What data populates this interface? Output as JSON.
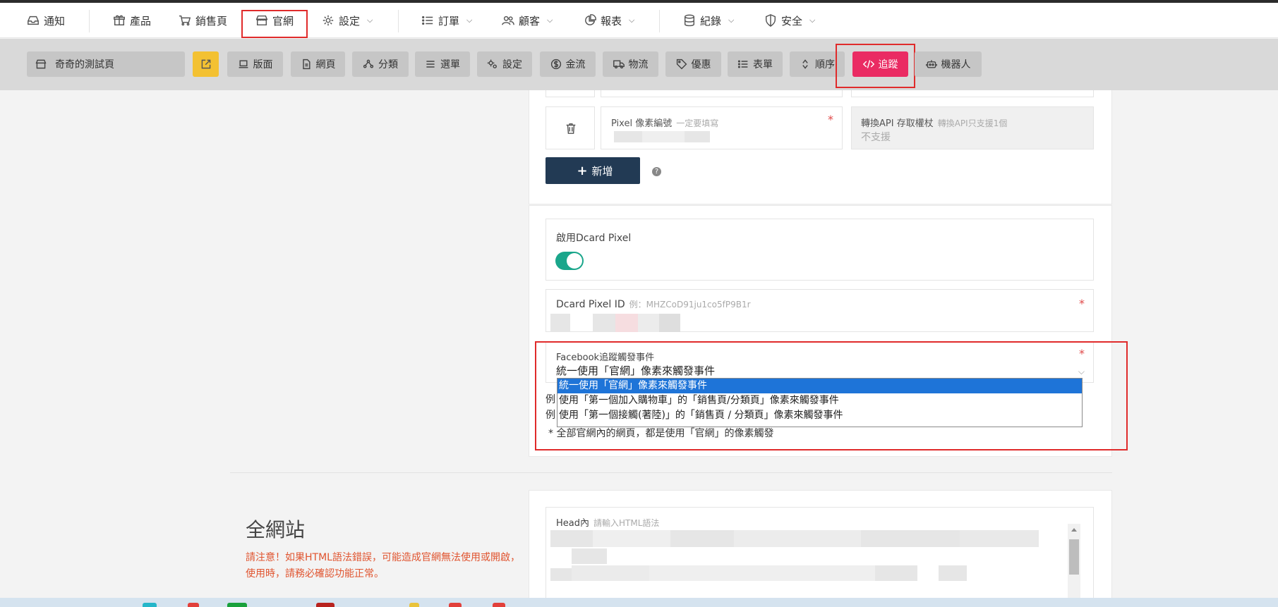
{
  "topnav": {
    "items": [
      {
        "label": "通知",
        "icon": "inbox-icon",
        "caret": false
      },
      {
        "label": "產品",
        "icon": "gift-icon",
        "caret": false
      },
      {
        "label": "銷售頁",
        "icon": "cart-icon",
        "caret": false
      },
      {
        "label": "官網",
        "icon": "store-icon",
        "caret": false
      },
      {
        "label": "設定",
        "icon": "gear-icon",
        "caret": true
      },
      {
        "label": "訂單",
        "icon": "list-icon",
        "caret": true
      },
      {
        "label": "顧客",
        "icon": "users-icon",
        "caret": true
      },
      {
        "label": "報表",
        "icon": "chart-pie-icon",
        "caret": true
      },
      {
        "label": "紀錄",
        "icon": "database-icon",
        "caret": true
      },
      {
        "label": "安全",
        "icon": "shield-icon",
        "caret": true
      }
    ]
  },
  "toolbar": {
    "site_name": "奇奇的測試頁",
    "buttons": [
      {
        "label": "版面",
        "icon": "laptop-icon"
      },
      {
        "label": "網頁",
        "icon": "file-icon"
      },
      {
        "label": "分類",
        "icon": "nodes-icon"
      },
      {
        "label": "選單",
        "icon": "menu-icon"
      },
      {
        "label": "設定",
        "icon": "gears-icon"
      },
      {
        "label": "金流",
        "icon": "dollar-icon"
      },
      {
        "label": "物流",
        "icon": "truck-icon"
      },
      {
        "label": "優惠",
        "icon": "tag-icon"
      },
      {
        "label": "表單",
        "icon": "list-icon"
      },
      {
        "label": "順序",
        "icon": "sort-icon"
      },
      {
        "label": "追蹤",
        "icon": "code-icon"
      },
      {
        "label": "機器人",
        "icon": "robot-icon"
      }
    ],
    "active": "追蹤"
  },
  "pixel_row": {
    "pixel_label": "Pixel 像素編號",
    "pixel_hint": "一定要填寫",
    "capi_label": "轉換API 存取權杖",
    "capi_hint": "轉換API只支援1個",
    "capi_value": "不支援"
  },
  "add_button": {
    "icon": "plus",
    "label": "新增"
  },
  "help_icon": "?",
  "dcard": {
    "enable_label": "啟用Dcard Pixel",
    "enabled": true,
    "id_label": "Dcard Pixel ID",
    "id_hint": "例：MHZCoD91ju1co5fP9B1r"
  },
  "fb_event": {
    "label": "Facebook追蹤觸發事件",
    "selected": "統一使用「官網」像素來觸發事件",
    "options": [
      "統一使用「官網」像素來觸發事件",
      "使用「第一個加入購物車」的「銷售頁/分類頁」像素來觸發事件",
      "使用「第一個接觸(著陸)」的「銷售頁 / 分類頁」像素來觸發事件"
    ],
    "note_prefix_1": "例",
    "note_prefix_2": "例",
    "note": "* 全部官網內的網頁，都是使用「官網」的像素觸發"
  },
  "sitewide": {
    "title": "全網站",
    "warning": "請注意！如果HTML語法錯誤，可能造成官網無法使用或開啟，使用時，請務必確認功能正常。",
    "head_label": "Head內",
    "head_hint": "請輸入HTML語法"
  },
  "colors": {
    "accent_active": "#ea2b63",
    "toggle_on": "#1aa68b",
    "primary_button": "#223a54",
    "highlight_box": "#e02b2b",
    "warning_text": "#e0542f"
  }
}
